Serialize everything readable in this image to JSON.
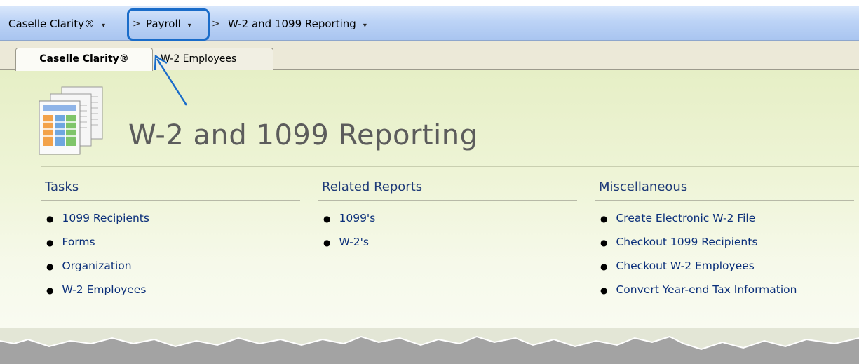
{
  "breadcrumb": {
    "items": [
      {
        "label": "Caselle Clarity®"
      },
      {
        "label": "Payroll"
      },
      {
        "label": "W-2 and 1099 Reporting"
      }
    ],
    "separator": ">",
    "dropdown_glyph": "▾"
  },
  "tabs": [
    {
      "label": "Caselle Clarity®",
      "active": true
    },
    {
      "label": "W-2 Employees",
      "active": false
    }
  ],
  "page": {
    "title": "W-2 and 1099 Reporting",
    "icon": "report-documents-icon"
  },
  "columns": [
    {
      "title": "Tasks",
      "links": [
        "1099 Recipients",
        "Forms",
        "Organization",
        "W-2 Employees"
      ]
    },
    {
      "title": "Related Reports",
      "links": [
        "1099's",
        "W-2's"
      ]
    },
    {
      "title": "Miscellaneous",
      "links": [
        "Create Electronic W-2 File",
        "Checkout 1099 Recipients",
        "Checkout W-2 Employees",
        "Convert Year-end Tax Information"
      ]
    }
  ],
  "colors": {
    "highlight": "#1a6cc9",
    "link": "#0b2f7a",
    "section_title": "#1e3a78"
  }
}
